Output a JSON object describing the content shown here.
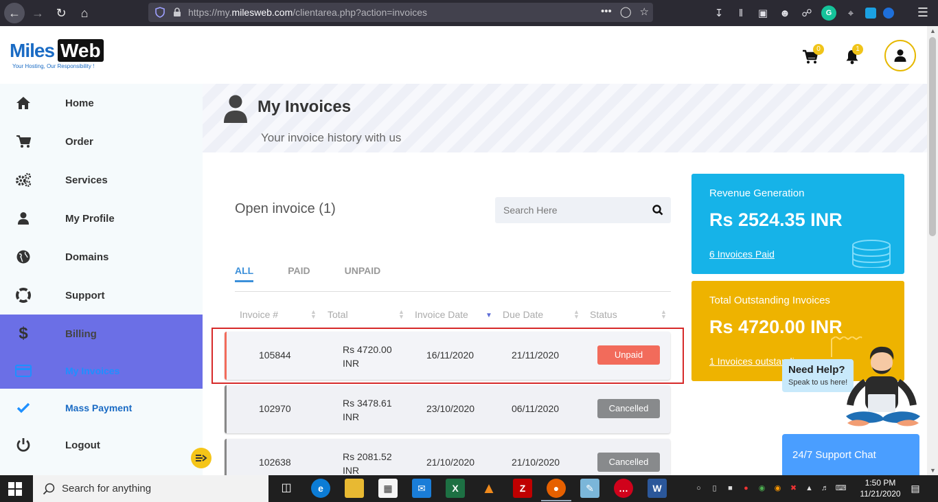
{
  "browser": {
    "url_prefix": "https://my.",
    "url_domain": "milesweb.com",
    "url_path": "/clientarea.php?action=invoices"
  },
  "header": {
    "logo_left": "Miles",
    "logo_right": "Web",
    "logo_tagline": "Your Hosting, Our Responsibility !",
    "cart_count": "0",
    "notification_count": "1"
  },
  "sidebar": {
    "items": [
      {
        "label": "Home",
        "icon": "home-icon"
      },
      {
        "label": "Order",
        "icon": "cart-icon"
      },
      {
        "label": "Services",
        "icon": "gears-icon"
      },
      {
        "label": "My Profile",
        "icon": "user-icon"
      },
      {
        "label": "Domains",
        "icon": "globe-icon"
      },
      {
        "label": "Support",
        "icon": "lifebuoy-icon"
      },
      {
        "label": "Billing",
        "icon": "dollar-icon"
      },
      {
        "label": "My Invoices",
        "icon": "credit-card-icon"
      },
      {
        "label": "Mass Payment",
        "icon": "check-icon"
      },
      {
        "label": "Logout",
        "icon": "power-icon"
      }
    ]
  },
  "page": {
    "title": "My Invoices",
    "subtitle": "Your invoice history with us",
    "open_invoice_title": "Open invoice (1)",
    "search_placeholder": "Search Here"
  },
  "tabs": [
    {
      "label": "ALL",
      "active": true
    },
    {
      "label": "PAID",
      "active": false
    },
    {
      "label": "UNPAID",
      "active": false
    }
  ],
  "table": {
    "columns": [
      "Invoice #",
      "Total",
      "Invoice Date",
      "Due Date",
      "Status"
    ],
    "rows": [
      {
        "invoice": "105844",
        "total_line1": "Rs 4720.00",
        "total_line2": "INR",
        "invoice_date": "16/11/2020",
        "due_date": "21/11/2020",
        "status": "Unpaid"
      },
      {
        "invoice": "102970",
        "total_line1": "Rs 3478.61",
        "total_line2": "INR",
        "invoice_date": "23/10/2020",
        "due_date": "06/11/2020",
        "status": "Cancelled"
      },
      {
        "invoice": "102638",
        "total_line1": "Rs 2081.52",
        "total_line2": "INR",
        "invoice_date": "21/10/2020",
        "due_date": "21/10/2020",
        "status": "Cancelled"
      }
    ]
  },
  "cards": {
    "revenue": {
      "title": "Revenue Generation",
      "value": "Rs 2524.35 INR",
      "link": "6 Invoices Paid"
    },
    "outstanding": {
      "title": "Total Outstanding Invoices",
      "value": "Rs 4720.00 INR",
      "link": "1 Invoices outstanding"
    }
  },
  "chat": {
    "help_title": "Need Help?",
    "help_sub": "Speak to us here!",
    "support_label": "24/7 Support Chat"
  },
  "taskbar": {
    "search_text": "Search for anything",
    "time": "1:50 PM",
    "date": "11/21/2020"
  },
  "colors": {
    "accent": "#6b6fe6",
    "link_blue": "#3b8fd9",
    "unpaid": "#f26b5b",
    "cancelled": "#888a8c",
    "card_blue": "#16b3e8",
    "card_yellow": "#eeb300",
    "highlight_red": "#d62828"
  }
}
